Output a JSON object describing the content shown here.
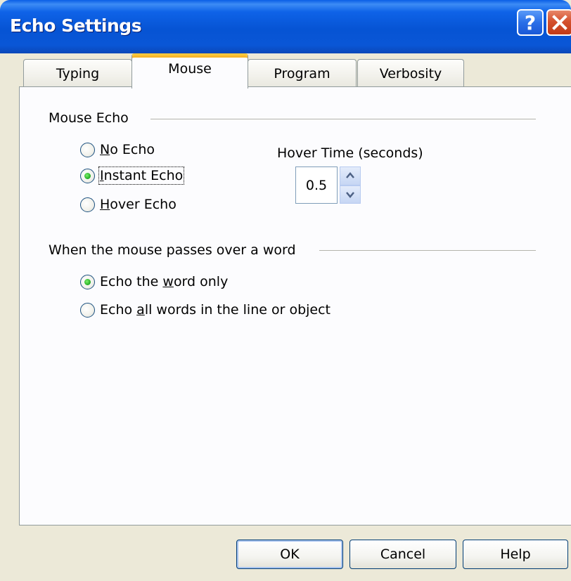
{
  "window": {
    "title": "Echo Settings",
    "help_glyph": "?",
    "icons": [
      "help-icon",
      "close-icon"
    ]
  },
  "tabs": [
    {
      "label": "Typing",
      "active": false
    },
    {
      "label": "Mouse",
      "active": true
    },
    {
      "label": "Program",
      "active": false
    },
    {
      "label": "Verbosity",
      "active": false
    }
  ],
  "mouse_echo": {
    "group_label": "Mouse Echo",
    "options": [
      {
        "pre": "",
        "key": "N",
        "post": "o Echo",
        "checked": false
      },
      {
        "pre": "",
        "key": "I",
        "post": "nstant Echo",
        "checked": true
      },
      {
        "pre": "",
        "key": "H",
        "post": "over Echo",
        "checked": false
      }
    ]
  },
  "hover_time": {
    "label": "Hover Time (seconds)",
    "value": "0.5",
    "icons": [
      "spin-up-icon",
      "spin-down-icon"
    ]
  },
  "word_group": {
    "group_label": "When the mouse passes over a word",
    "options": [
      {
        "pre": "Echo the ",
        "key": "w",
        "post": "ord only",
        "checked": true
      },
      {
        "pre": "Echo ",
        "key": "a",
        "post": "ll words in the line or object",
        "checked": false
      }
    ]
  },
  "buttons": {
    "ok": "OK",
    "cancel": "Cancel",
    "help": "Help"
  },
  "colors": {
    "titlebar": "#0654d4",
    "dialog_bg": "#ece9d8",
    "panel_bg": "#fcfcfe",
    "active_tab_accent": "#ffc83c",
    "radio_checked": "#2ab32a",
    "close_button": "#c23a16"
  }
}
